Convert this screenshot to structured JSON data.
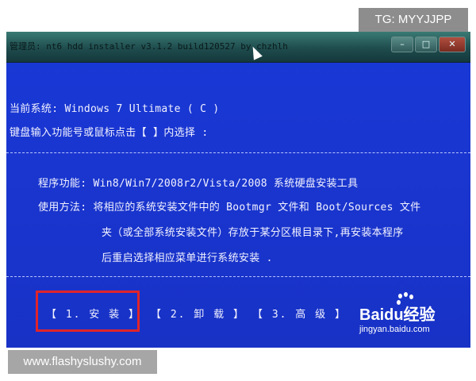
{
  "watermarks": {
    "top_right": "TG: MYYJJPP",
    "bottom_left": "www.flashyslushy.com"
  },
  "window": {
    "title": "管理员: nt6 hdd installer v3.1.2 build120527 by chzhlh",
    "buttons": [
      "–",
      "□",
      "✕"
    ]
  },
  "console": {
    "current_system": "当前系统: Windows 7 Ultimate ( C )",
    "prompt": "键盘输入功能号或鼠标点击【 】内选择 :",
    "program_function": "程序功能: Win8/Win7/2008r2/Vista/2008 系统硬盘安装工具",
    "usage_line1": "使用方法: 将相应的系统安装文件中的 Bootmgr 文件和 Boot/Sources 文件",
    "usage_line2": "夹（或全部系统安装文件）存放于某分区根目录下,再安装本程序",
    "usage_line3": "后重启选择相应菜单进行系统安装 ."
  },
  "menu": {
    "items": [
      {
        "label": "【 1. 安 装 】"
      },
      {
        "label": "【 2. 卸 载 】"
      },
      {
        "label": "【 3. 高 级 】"
      }
    ],
    "selected_index": 0
  },
  "logo": {
    "name": "Baidu经验",
    "url_text": "jingyan.baidu.com"
  },
  "colors": {
    "console_bg": "#1a36d0",
    "highlight_border": "#e0242a"
  }
}
